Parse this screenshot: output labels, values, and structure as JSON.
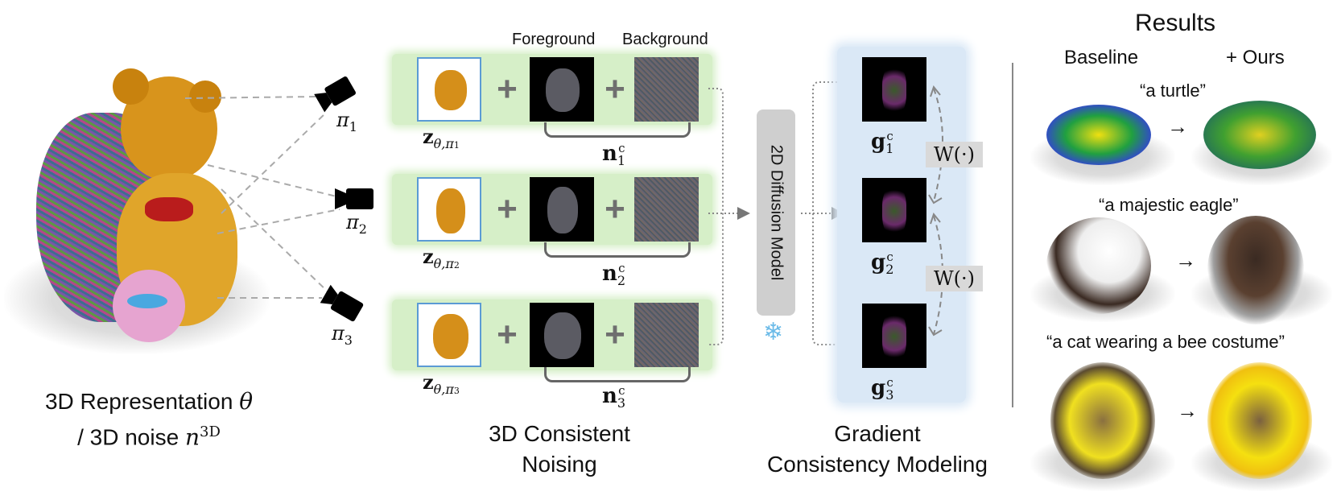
{
  "left": {
    "caption_line1": "3D Representation",
    "caption_theta": "θ",
    "caption_line2": "/ 3D noise",
    "caption_n": "n",
    "caption_n_sup": "3D",
    "cameras": [
      {
        "symbol": "π",
        "sub": "1"
      },
      {
        "symbol": "π",
        "sub": "2"
      },
      {
        "symbol": "π",
        "sub": "3"
      }
    ]
  },
  "noising": {
    "header_foreground": "Foreground",
    "header_background": "Background",
    "plus": "+",
    "rows": [
      {
        "z": "z",
        "z_sub": "θ,π",
        "z_sub_idx": "1",
        "n": "n",
        "n_sub": "1",
        "n_sup": "c"
      },
      {
        "z": "z",
        "z_sub": "θ,π",
        "z_sub_idx": "2",
        "n": "n",
        "n_sub": "2",
        "n_sup": "c"
      },
      {
        "z": "z",
        "z_sub": "θ,π",
        "z_sub_idx": "3",
        "n": "n",
        "n_sub": "3",
        "n_sup": "c"
      }
    ],
    "caption_line1": "3D Consistent",
    "caption_line2": "Noising"
  },
  "diffusion": {
    "label": "2D Diffusion Model",
    "frozen_icon": "❄"
  },
  "gradient": {
    "items": [
      {
        "g": "g",
        "sub": "1",
        "sup": "c"
      },
      {
        "g": "g",
        "sub": "2",
        "sup": "c"
      },
      {
        "g": "g",
        "sub": "3",
        "sup": "c"
      }
    ],
    "weights": [
      "W(·)",
      "W(·)"
    ],
    "caption_line1": "Gradient",
    "caption_line2": "Consistency Modeling"
  },
  "results": {
    "title": "Results",
    "col_baseline": "Baseline",
    "col_ours": "+ Ours",
    "arrow": "→",
    "prompts": [
      "“a turtle”",
      "“a majestic eagle”",
      "“a cat wearing a bee costume”"
    ]
  },
  "colors": {
    "noising_bg": "#d6efc8",
    "gradient_bg": "#dae8f6",
    "diffusion_box": "#cfcfcf",
    "thumb_border": "#5b9bd5"
  }
}
